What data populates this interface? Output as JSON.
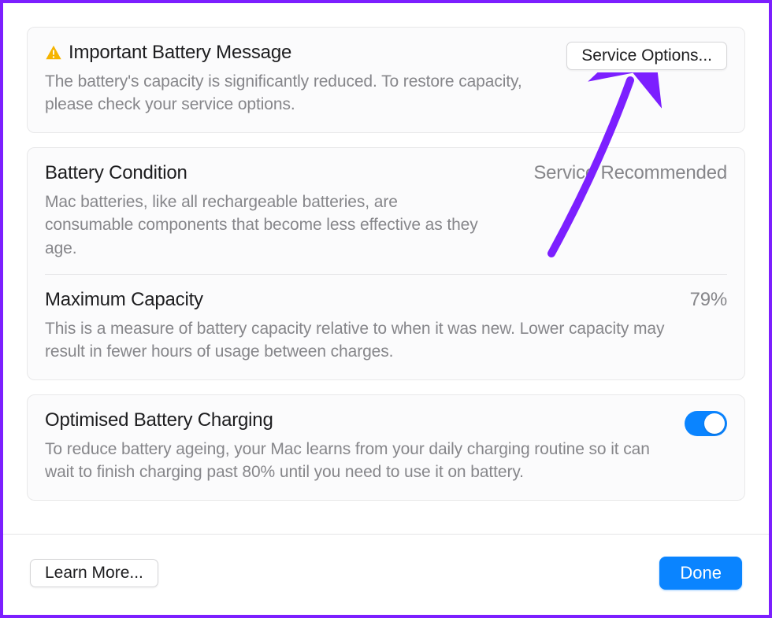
{
  "warning": {
    "title": "Important Battery Message",
    "description": "The battery's capacity is significantly reduced. To restore capacity, please check your service options.",
    "service_button": "Service Options..."
  },
  "condition": {
    "title": "Battery Condition",
    "status": "Service Recommended",
    "description": "Mac batteries, like all rechargeable batteries, are consumable components that become less effective as they age."
  },
  "capacity": {
    "title": "Maximum Capacity",
    "value": "79%",
    "description": "This is a measure of battery capacity relative to when it was new. Lower capacity may result in fewer hours of usage between charges."
  },
  "optimised": {
    "title": "Optimised Battery Charging",
    "enabled": true,
    "description": "To reduce battery ageing, your Mac learns from your daily charging routine so it can wait to finish charging past 80% until you need to use it on battery."
  },
  "footer": {
    "learn_more": "Learn More...",
    "done": "Done"
  },
  "colors": {
    "accent": "#0a84ff",
    "annotation": "#7c1fff",
    "warning_icon": "#f5b400"
  }
}
